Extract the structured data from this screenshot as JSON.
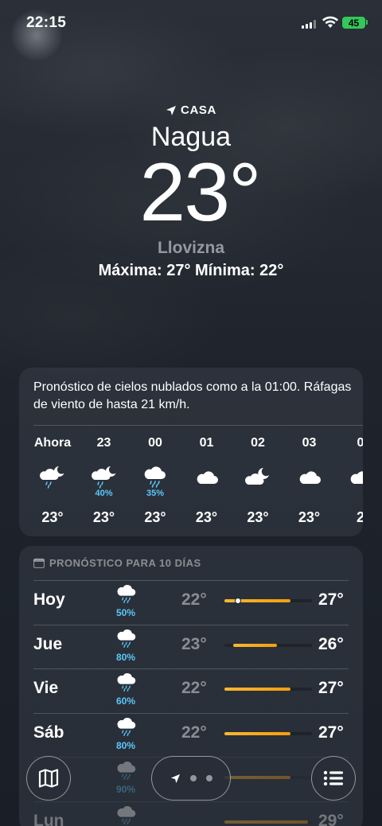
{
  "status": {
    "time": "22:15",
    "battery": "45"
  },
  "header": {
    "location_label": "CASA",
    "city": "Nagua",
    "temperature": "23°",
    "condition": "Llovizna",
    "high_low": "Máxima: 27°  Mínima: 22°"
  },
  "hourly": {
    "summary": "Pronóstico de cielos nublados como a la 01:00. Ráfagas de viento de hasta 21 km/h.",
    "hours": [
      {
        "label": "Ahora",
        "icon": "rain-partly-cloudy-night-icon",
        "precip": "",
        "temp": "23°"
      },
      {
        "label": "23",
        "icon": "rain-partly-cloudy-night-icon",
        "precip": "40%",
        "temp": "23°"
      },
      {
        "label": "00",
        "icon": "rain-cloud-icon",
        "precip": "35%",
        "temp": "23°"
      },
      {
        "label": "01",
        "icon": "cloud-icon",
        "precip": "",
        "temp": "23°"
      },
      {
        "label": "02",
        "icon": "partly-cloudy-night-icon",
        "precip": "",
        "temp": "23°"
      },
      {
        "label": "03",
        "icon": "cloud-icon",
        "precip": "",
        "temp": "23°"
      },
      {
        "label": "0",
        "icon": "cloud-icon",
        "precip": "",
        "temp": "2"
      }
    ]
  },
  "daily": {
    "heading": "PRONÓSTICO PARA 10 DÍAS",
    "days": [
      {
        "name": "Hoy",
        "precip": "50%",
        "low": "22°",
        "high": "27°",
        "bar_start": 0.0,
        "bar_end": 0.75,
        "now": 0.15
      },
      {
        "name": "Jue",
        "precip": "80%",
        "low": "23°",
        "high": "26°",
        "bar_start": 0.1,
        "bar_end": 0.6
      },
      {
        "name": "Vie",
        "precip": "60%",
        "low": "22°",
        "high": "27°",
        "bar_start": 0.0,
        "bar_end": 0.75
      },
      {
        "name": "Sáb",
        "precip": "80%",
        "low": "22°",
        "high": "27°",
        "bar_start": 0.0,
        "bar_end": 0.75
      },
      {
        "name": "",
        "precip": "90%",
        "low": "",
        "high": "",
        "bar_start": 0.0,
        "bar_end": 0.75
      },
      {
        "name": "Lun",
        "precip": "",
        "low": "",
        "high": "29°",
        "bar_start": 0.0,
        "bar_end": 0.95
      }
    ]
  },
  "colors": {
    "accent_precip": "#5ac8fa",
    "temp_bar": "#f7b733",
    "battery": "#34c759"
  }
}
